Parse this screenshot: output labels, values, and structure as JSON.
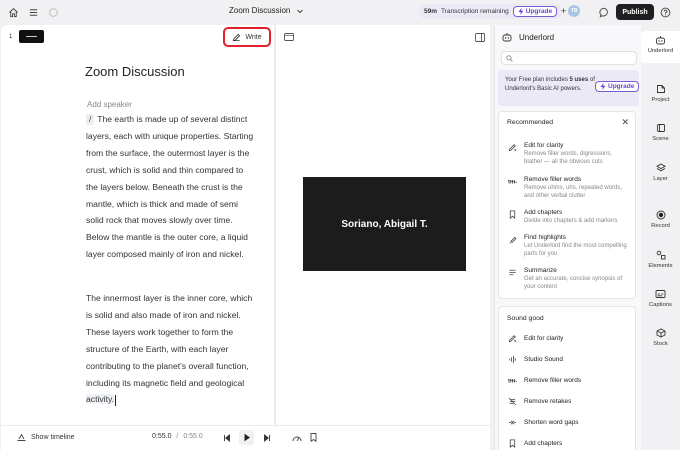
{
  "topbar": {
    "project_title": "Zoom Discussion",
    "transcription_minutes": "59m",
    "transcription_label": "Transcription remaining",
    "upgrade_label": "Upgrade",
    "collab_plus": "+",
    "avatar_initials": "TB",
    "publish_label": "Publish"
  },
  "script": {
    "scene_number": "1",
    "write_label": "Write",
    "title": "Zoom Discussion",
    "add_speaker": "Add speaker",
    "slash": "/",
    "para1": "The earth is made up of several distinct layers, each with unique properties. Starting from the surface, the outermost layer is the crust, which is solid and thin compared to the layers below. Beneath the crust is the mantle, which is thick and made of semi solid rock that moves slowly over time. Below the mantle is the outer core, a liquid layer composed mainly of iron and nickel.",
    "para2_main": "The innermost layer is the inner core, which is solid and also made of iron and nickel. These layers work together to form the structure of the Earth, with each layer contributing to the planet's overall function, including its magnetic field and geological",
    "para2_last": "activity."
  },
  "preview": {
    "caption": "Soriano, Abigail T."
  },
  "bottombar": {
    "show_timeline": "Show timeline",
    "current_time": "0:55.0",
    "separator": "/",
    "total_time": "0:55.0"
  },
  "underlord": {
    "title": "Underlord",
    "search_placeholder": "",
    "plan_text_1": "Your Free plan includes ",
    "plan_uses": "5 uses",
    "plan_text_2": " of Underlord's Basic AI powers.",
    "plan_upgrade": "Upgrade",
    "recommended_title": "Recommended",
    "recommended": [
      {
        "title": "Edit for clarity",
        "desc": "Remove filler words, digressions, blather — all the obvious cuts",
        "icon": "sparkle-pen-icon"
      },
      {
        "title": "Remove filler words",
        "desc": "Remove uhms, uhs, repeated words, and other verbal clutter",
        "icon": "filler-words-icon"
      },
      {
        "title": "Add chapters",
        "desc": "Divide into chapters & add markers",
        "icon": "bookmark-icon"
      },
      {
        "title": "Find highlights",
        "desc": "Let Underlord find the most compelling parts for you",
        "icon": "highlight-icon"
      },
      {
        "title": "Summarize",
        "desc": "Get an accurate, concise synopsis of your content",
        "icon": "summarize-icon"
      }
    ],
    "sound_good_title": "Sound good",
    "sound_good": [
      {
        "title": "Edit for clarity",
        "icon": "sparkle-pen-icon"
      },
      {
        "title": "Studio Sound",
        "icon": "studio-sound-icon"
      },
      {
        "title": "Remove filler words",
        "icon": "filler-words-icon"
      },
      {
        "title": "Remove retakes",
        "icon": "retakes-icon"
      },
      {
        "title": "Shorten word gaps",
        "icon": "word-gaps-icon"
      },
      {
        "title": "Add chapters",
        "icon": "bookmark-icon"
      }
    ]
  },
  "rnav": {
    "items": [
      {
        "label": "Underlord",
        "icon": "underlord-icon"
      },
      {
        "label": "Project",
        "icon": "project-icon"
      },
      {
        "label": "Scene",
        "icon": "scene-icon"
      },
      {
        "label": "Layer",
        "icon": "layer-icon"
      },
      {
        "label": "Record",
        "icon": "record-icon"
      },
      {
        "label": "Elements",
        "icon": "elements-icon"
      },
      {
        "label": "Captions",
        "icon": "captions-icon"
      },
      {
        "label": "Stock",
        "icon": "stock-icon"
      }
    ]
  },
  "colors": {
    "accent_purple": "#6a45d0",
    "highlight_red": "#e0202a",
    "publish_bg": "#1f1f22"
  }
}
